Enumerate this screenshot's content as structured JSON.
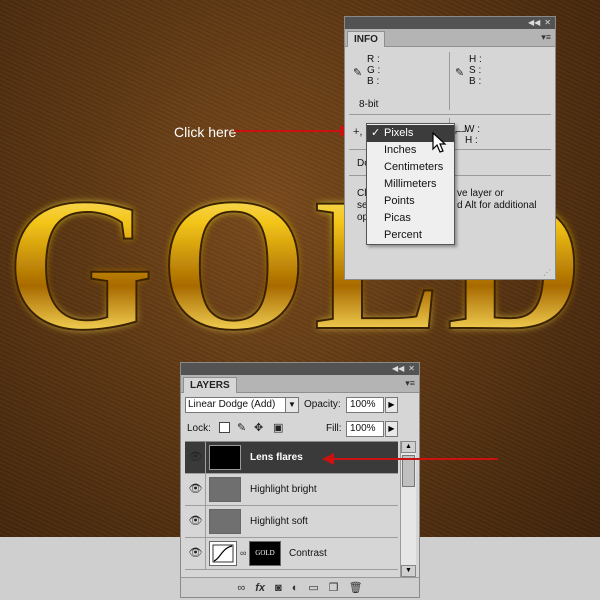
{
  "annotation": {
    "click_here": "Click here"
  },
  "canvas_text": {
    "word": "GOLD"
  },
  "info_panel": {
    "tab": "INFO",
    "rgb": [
      "R :",
      "G :",
      "B :"
    ],
    "hsb": [
      "H :",
      "S :",
      "B :"
    ],
    "bit_depth": "8-bit",
    "xy_partial": "X",
    "wh": [
      "W :",
      "H :"
    ],
    "doc_partial": "Do",
    "help_lines": [
      "Cl",
      "se",
      "op"
    ],
    "help_right_lines": [
      "ve layer or",
      "d Alt for additional"
    ]
  },
  "units_menu": {
    "items": [
      "Pixels",
      "Inches",
      "Centimeters",
      "Millimeters",
      "Points",
      "Picas",
      "Percent"
    ],
    "selected": "Pixels",
    "check": "✓"
  },
  "layers_panel": {
    "tab": "LAYERS",
    "blend_mode": "Linear Dodge (Add)",
    "opacity_label": "Opacity:",
    "opacity_value": "100%",
    "lock_label": "Lock:",
    "fill_label": "Fill:",
    "fill_value": "100%",
    "layers": [
      {
        "name": "Lens flares",
        "active": true
      },
      {
        "name": "Highlight bright",
        "active": false
      },
      {
        "name": "Highlight soft",
        "active": false
      },
      {
        "name": "Contrast",
        "active": false,
        "mask_text": "GOLD"
      }
    ],
    "footer_icons": [
      "link-icon",
      "fx-icon",
      "mask-icon",
      "adjustment-icon",
      "folder-icon",
      "new-layer-icon",
      "trash-icon"
    ],
    "fx_text": "fx"
  },
  "colors": {
    "accent_arrow": "#cc1111",
    "selected_menu": "#3c3c3c",
    "panel_bg": "#d6d6d6"
  }
}
